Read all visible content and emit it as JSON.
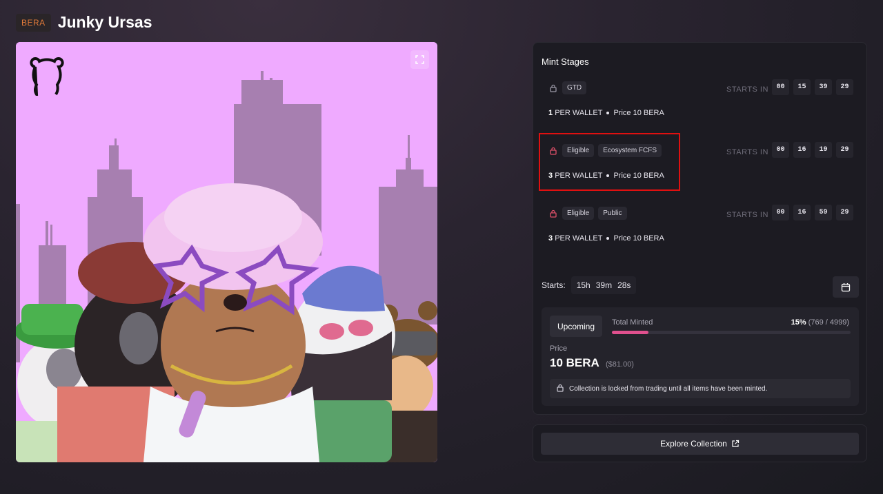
{
  "header": {
    "chain_badge": "BERA",
    "title": "Junky Ursas"
  },
  "mint_stages": {
    "title": "Mint Stages",
    "stages": [
      {
        "tags": [
          "GTD"
        ],
        "starts_label": "STARTS IN",
        "countdown": [
          "00",
          "15",
          "39",
          "29"
        ],
        "per_wallet_count": "1",
        "per_wallet_label": "PER WALLET",
        "price": "Price 10 BERA"
      },
      {
        "tags": [
          "Eligible",
          "Ecosystem FCFS"
        ],
        "starts_label": "STARTS IN",
        "countdown": [
          "00",
          "16",
          "19",
          "29"
        ],
        "per_wallet_count": "3",
        "per_wallet_label": "PER WALLET",
        "price": "Price 10 BERA"
      },
      {
        "tags": [
          "Eligible",
          "Public"
        ],
        "starts_label": "STARTS IN",
        "countdown": [
          "00",
          "16",
          "59",
          "29"
        ],
        "per_wallet_count": "3",
        "per_wallet_label": "PER WALLET",
        "price": "Price 10 BERA"
      }
    ]
  },
  "starts": {
    "label": "Starts:",
    "hours": "15h",
    "minutes": "39m",
    "seconds": "28s"
  },
  "mint_status": {
    "status_button": "Upcoming",
    "total_minted_label": "Total Minted",
    "percent": "15%",
    "count": "(769 / 4999)",
    "progress_fraction": 0.154,
    "price_label": "Price",
    "price_value": "10 BERA",
    "price_usd": "($81.00)",
    "notice": "Collection is locked from trading until all items have been minted."
  },
  "explore": {
    "label": "Explore Collection"
  },
  "colors": {
    "accent": "#e0508e",
    "highlight": "#e01010",
    "art_bg": "#efaaff",
    "chain": "#e07a3a"
  },
  "icons": {
    "lock": "lock-icon",
    "expand": "expand-icon",
    "calendar": "calendar-icon",
    "external": "external-link-icon",
    "logo": "bear-logo-icon"
  }
}
